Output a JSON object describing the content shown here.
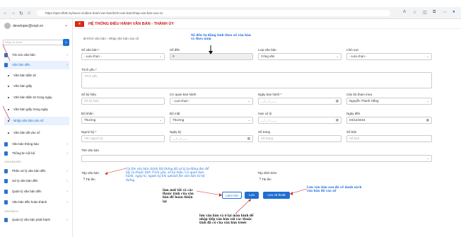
{
  "browser": {
    "address": "https://qan-dhdt.myhanoi.vn/dieu-hanh-van-ban/trinh-van-ban/nhap-van-ban-vao-so"
  },
  "sidebar": {
    "user": "developer@vnpt.vn",
    "search_placeholder": "Nhập từ khóa",
    "items": [
      {
        "label": "Trả cứu văn bản",
        "type": "icon"
      },
      {
        "label": "Văn bản đến",
        "type": "icon",
        "active": true
      },
      {
        "label": "Văn bản điện tử",
        "type": "dot"
      },
      {
        "label": "Văn bản giấy",
        "type": "dot"
      },
      {
        "label": "Văn bản điện tử trong ngày",
        "type": "dot"
      },
      {
        "label": "Văn bản giấy trong ngày",
        "type": "dot"
      },
      {
        "label": "Nhập văn bản vào sổ",
        "type": "dot",
        "active": true
      },
      {
        "label": "Văn bản đã vào sổ",
        "type": "dot"
      },
      {
        "label": "Văn bản thông báo",
        "type": "icon"
      },
      {
        "label": "Thông tin nội bộ",
        "type": "icon"
      },
      {
        "label": "Phân xử lý văn bản đến",
        "type": "icon"
      },
      {
        "label": "Xử lý văn bản đến",
        "type": "icon"
      },
      {
        "label": "Quản lý văn bản đến",
        "type": "icon"
      },
      {
        "label": "Văn bản đến hoàn thành",
        "type": "icon"
      },
      {
        "label": "Quản lý văn bản phát hành",
        "type": "icon"
      }
    ],
    "sections": [
      "VĂN BẢN ĐẾN",
      "VĂN BẢN ĐI"
    ]
  },
  "header": {
    "title": "HỆ THỐNG ĐIỀU HÀNH VĂN BẢN - THÀNH ỦY"
  },
  "breadcrumb": {
    "home": "Khởi văn bản",
    "current": "Nhập văn bản vào sổ"
  },
  "form": {
    "row1": [
      {
        "label": "Sổ văn bản",
        "req": true,
        "value": "- Lựa chọn -",
        "select": true
      },
      {
        "label": "Số đến",
        "value": "0",
        "disabled": true
      },
      {
        "label": "Loại văn bản",
        "value": "Công văn",
        "select": true
      },
      {
        "label": "Lĩnh vực",
        "value": "- Lựa chọn -",
        "select": true
      }
    ],
    "summary_label": "Trích yếu",
    "summary_placeholder": "Trích yếu",
    "row2": [
      {
        "label": "Số ký hiệu",
        "value": "Số ký hiệu",
        "placeholder": true
      },
      {
        "label": "Cơ quan ban hành",
        "value": "- Lựa chọn -",
        "select": true
      },
      {
        "label": "Ngày ban hành",
        "req": true,
        "value": "__/__/____",
        "placeholder": true,
        "date": true
      },
      {
        "label": "Cán bộ tham mưu",
        "value": "Nguyễn Thanh Hằng",
        "select": true
      }
    ],
    "row3": [
      {
        "label": "Độ khẩn",
        "value": "Thường",
        "select": true
      },
      {
        "label": "Độ mật",
        "value": "Thường",
        "select": true
      },
      {
        "label": "Hạn xử lý",
        "value": "__/__/____",
        "placeholder": true,
        "date": true
      },
      {
        "label": "Ngày đến",
        "value": "04/12/2024",
        "date": true
      }
    ],
    "row4": [
      {
        "label": "Người ký",
        "req": true,
        "value": "Tên người ký",
        "placeholder": true
      },
      {
        "label": "Ngày ký",
        "value": "__/__/____",
        "placeholder": true,
        "date": true
      },
      {
        "label": "Số trang",
        "value": "Số trang",
        "placeholder": true
      },
      {
        "label": "Số bản",
        "value": "Số bản",
        "placeholder": true
      }
    ],
    "related_label": "Thẻ văn bản",
    "file_label": "Tệp văn bản",
    "file_button": "Tải lên",
    "attach_label": "Tệp đính kèm",
    "attach_button": "Tải lên",
    "buttons": {
      "new": "Làm mới",
      "save": "Lưu",
      "save_close": "Lưu và thoát"
    }
  },
  "annotations": {
    "auto_number": "Số đến tự động tính theo số văn bản và theo năm",
    "upload_note": "Up file văn bản chính Hệ thống đã xử lý tự động đọc để lấy ra thuộc tính Trích yếu, số ký hiệu, Cơ quan ban hành, ngày kí, người ký khi upload file văn bản từ hệ thống",
    "reset_note": "làm mới tất cả các thuộc tính của văn bản để hoàn thiện lại",
    "save_note": "lưu văn bản và ở lại màn hình để nhập tiếp văn bản với các thuộc tính đã có của văn bản trước",
    "save_close_note": "Lưu văn bản sau đó về danh sách văn bản đã vào sổ"
  }
}
